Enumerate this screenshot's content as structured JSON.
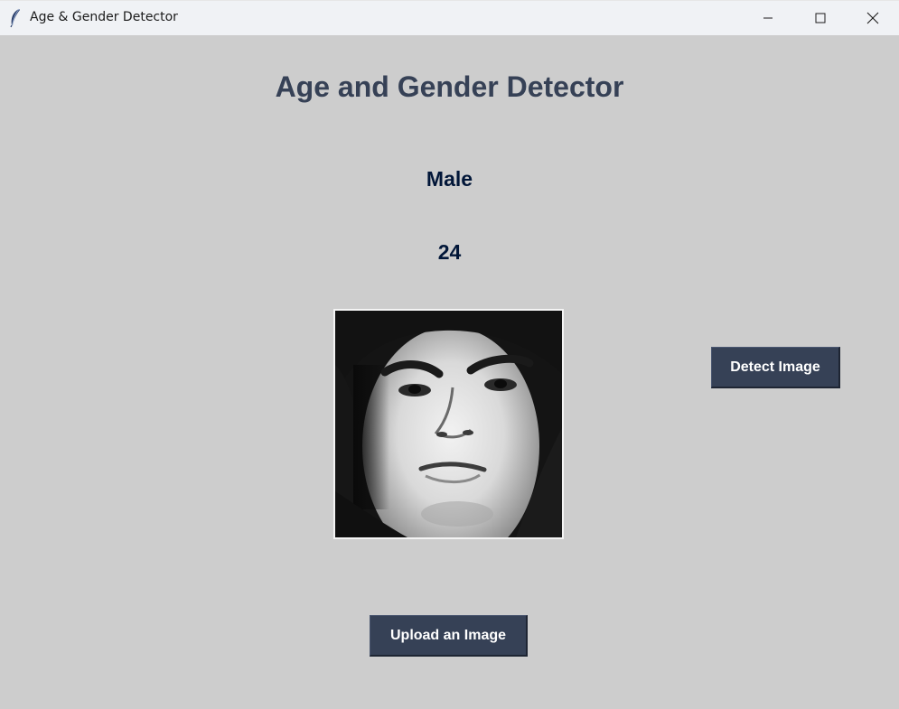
{
  "window": {
    "title": "Age & Gender Detector",
    "icon": "feather-icon",
    "controls": [
      "minimize-icon",
      "maximize-icon",
      "close-icon"
    ]
  },
  "main": {
    "heading": "Age and Gender Detector",
    "gender_result": "Male",
    "age_result": "24",
    "detect_button_label": "Detect Image",
    "upload_button_label": "Upload an Image"
  },
  "colors": {
    "background": "#cdcdcd",
    "heading": "#364156",
    "result_text": "#011638",
    "button_bg": "#364156",
    "button_text": "#ffffff"
  }
}
